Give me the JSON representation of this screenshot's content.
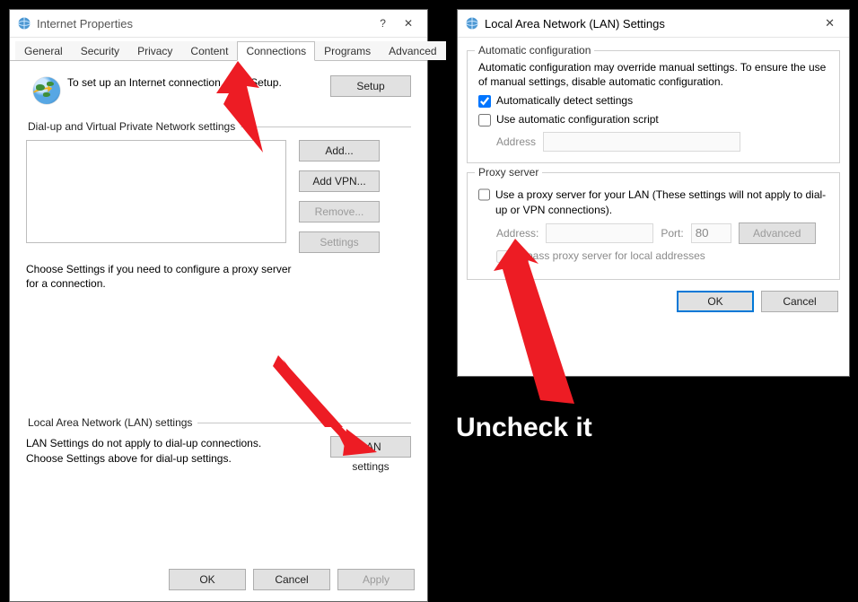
{
  "ip": {
    "title": "Internet Properties",
    "tabs": [
      "General",
      "Security",
      "Privacy",
      "Content",
      "Connections",
      "Programs",
      "Advanced"
    ],
    "activeTab": "Connections",
    "setupText": "To set up an Internet connection, click Setup.",
    "setupBtn": "Setup",
    "dialGroup": "Dial-up and Virtual Private Network settings",
    "addBtn": "Add...",
    "addVpnBtn": "Add VPN...",
    "removeBtn": "Remove...",
    "settingsBtn": "Settings",
    "dialNote": "Choose Settings if you need to configure a proxy server for a connection.",
    "lanGroup": "Local Area Network (LAN) settings",
    "lanNote": "LAN Settings do not apply to dial-up connections. Choose Settings above for dial-up settings.",
    "lanBtn": "LAN settings",
    "ok": "OK",
    "cancel": "Cancel",
    "apply": "Apply"
  },
  "lan": {
    "title": "Local Area Network (LAN) Settings",
    "autoLegend": "Automatic configuration",
    "autoDesc": "Automatic configuration may override manual settings.  To ensure the use of manual settings, disable automatic configuration.",
    "autoDetect": "Automatically detect settings",
    "autoDetectChecked": true,
    "useScript": "Use automatic configuration script",
    "useScriptChecked": false,
    "addressLabel": "Address",
    "proxyLegend": "Proxy server",
    "useProxy": "Use a proxy server for your LAN (These settings will not apply to dial-up or VPN connections).",
    "useProxyChecked": false,
    "proxyAddressLabel": "Address:",
    "portLabel": "Port:",
    "portValue": "80",
    "advancedBtn": "Advanced",
    "bypass": "Bypass proxy server for local addresses",
    "ok": "OK",
    "cancel": "Cancel"
  },
  "annotation": {
    "uncheck": "Uncheck it"
  }
}
